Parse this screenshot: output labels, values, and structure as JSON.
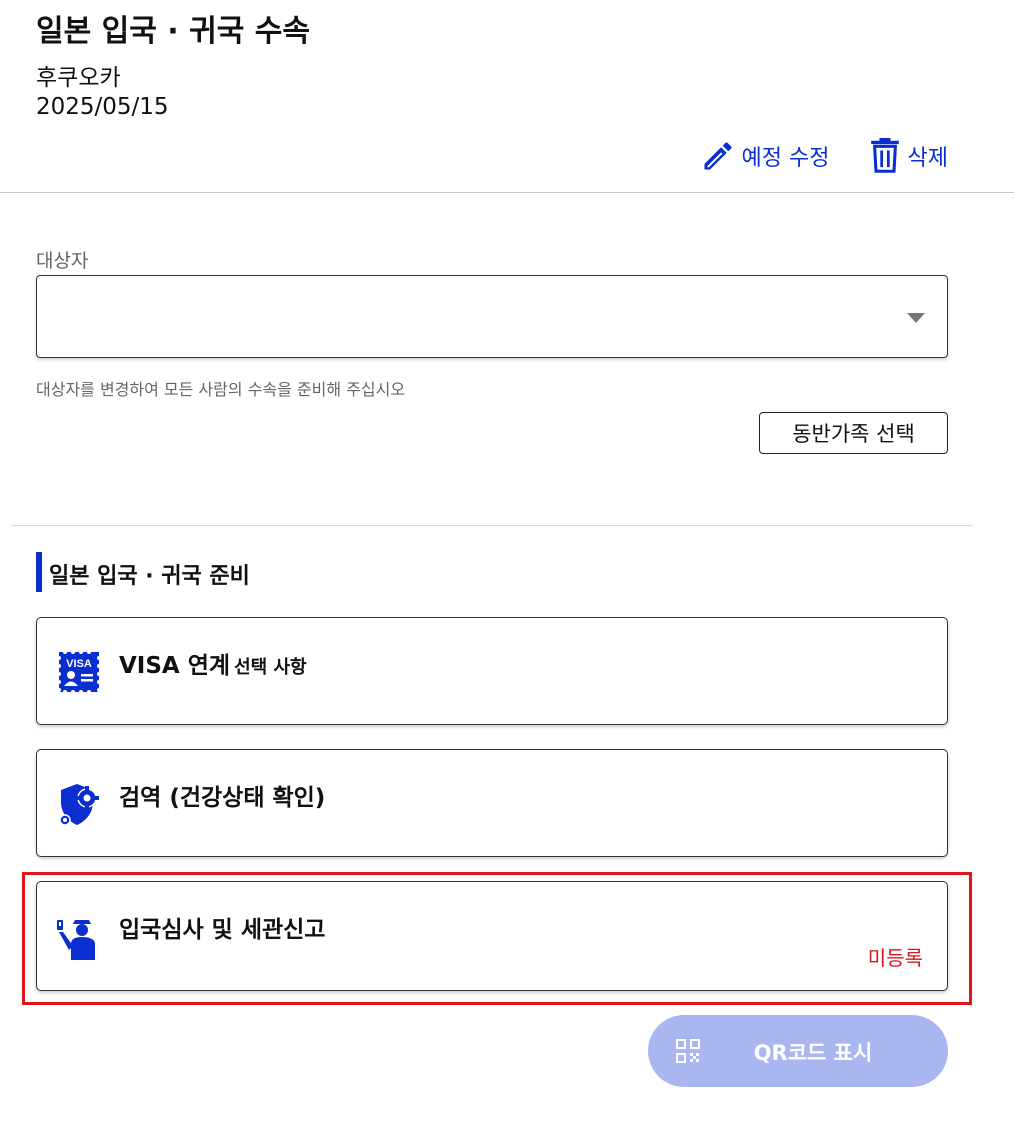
{
  "header": {
    "title": "일본 입국 · 귀국 수속",
    "destination": "후쿠오카",
    "date": "2025/05/15",
    "edit_label": "예정 수정",
    "delete_label": "삭제"
  },
  "target": {
    "label": "대상자",
    "value": "",
    "helper": "대상자를 변경하여 모든 사람의 수속을 준비해 주십시오",
    "family_button": "동반가족 선택"
  },
  "section": {
    "title": "일본 입국 · 귀국 준비",
    "cards": [
      {
        "title": "VISA 연계",
        "subtitle": "선택 사항",
        "status": "",
        "icon": "visa-icon"
      },
      {
        "title": "검역 (건강상태 확인)",
        "subtitle": "",
        "status": "",
        "icon": "health-shield-icon"
      },
      {
        "title": "입국심사 및 세관신고",
        "subtitle": "",
        "status": "미등록",
        "icon": "immigration-officer-icon"
      }
    ]
  },
  "qr_button": {
    "label": "QR코드 표시",
    "icon": "qr-code-icon"
  },
  "colors": {
    "accent": "#0b2ed1",
    "status_unregistered": "#d6161a",
    "qr_button_disabled": "#aab6f0",
    "highlight": "#e0141e"
  }
}
